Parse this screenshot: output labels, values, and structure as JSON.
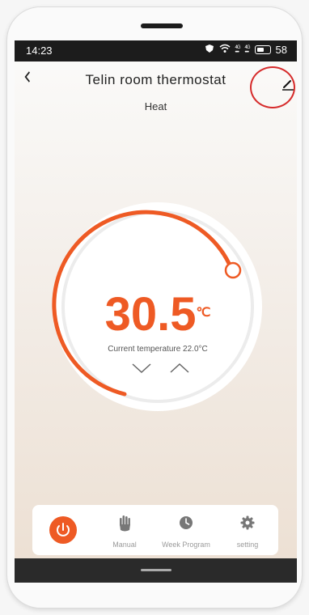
{
  "status_bar": {
    "time": "14:23",
    "icons": [
      "shield-icon",
      "wifi-icon",
      "signal-icon",
      "signal-icon",
      "battery-icon"
    ],
    "network_labels": [
      "4G",
      "4G"
    ],
    "battery_level": "58"
  },
  "header": {
    "title": "Telin room thermostat",
    "mode": "Heat"
  },
  "thermostat": {
    "set_temperature": "30.5",
    "unit": "℃",
    "current_temperature": "Current temperature 22.0°C",
    "accent_color": "#ee5a24"
  },
  "bottom_nav": {
    "items": [
      {
        "label": "",
        "icon": "power-icon",
        "active": true
      },
      {
        "label": "Manual",
        "icon": "hand-icon"
      },
      {
        "label": "Week Program",
        "icon": "clock-icon"
      },
      {
        "label": "setting",
        "icon": "gear-icon"
      }
    ]
  },
  "annotation": {
    "color": "#d62b2b"
  }
}
